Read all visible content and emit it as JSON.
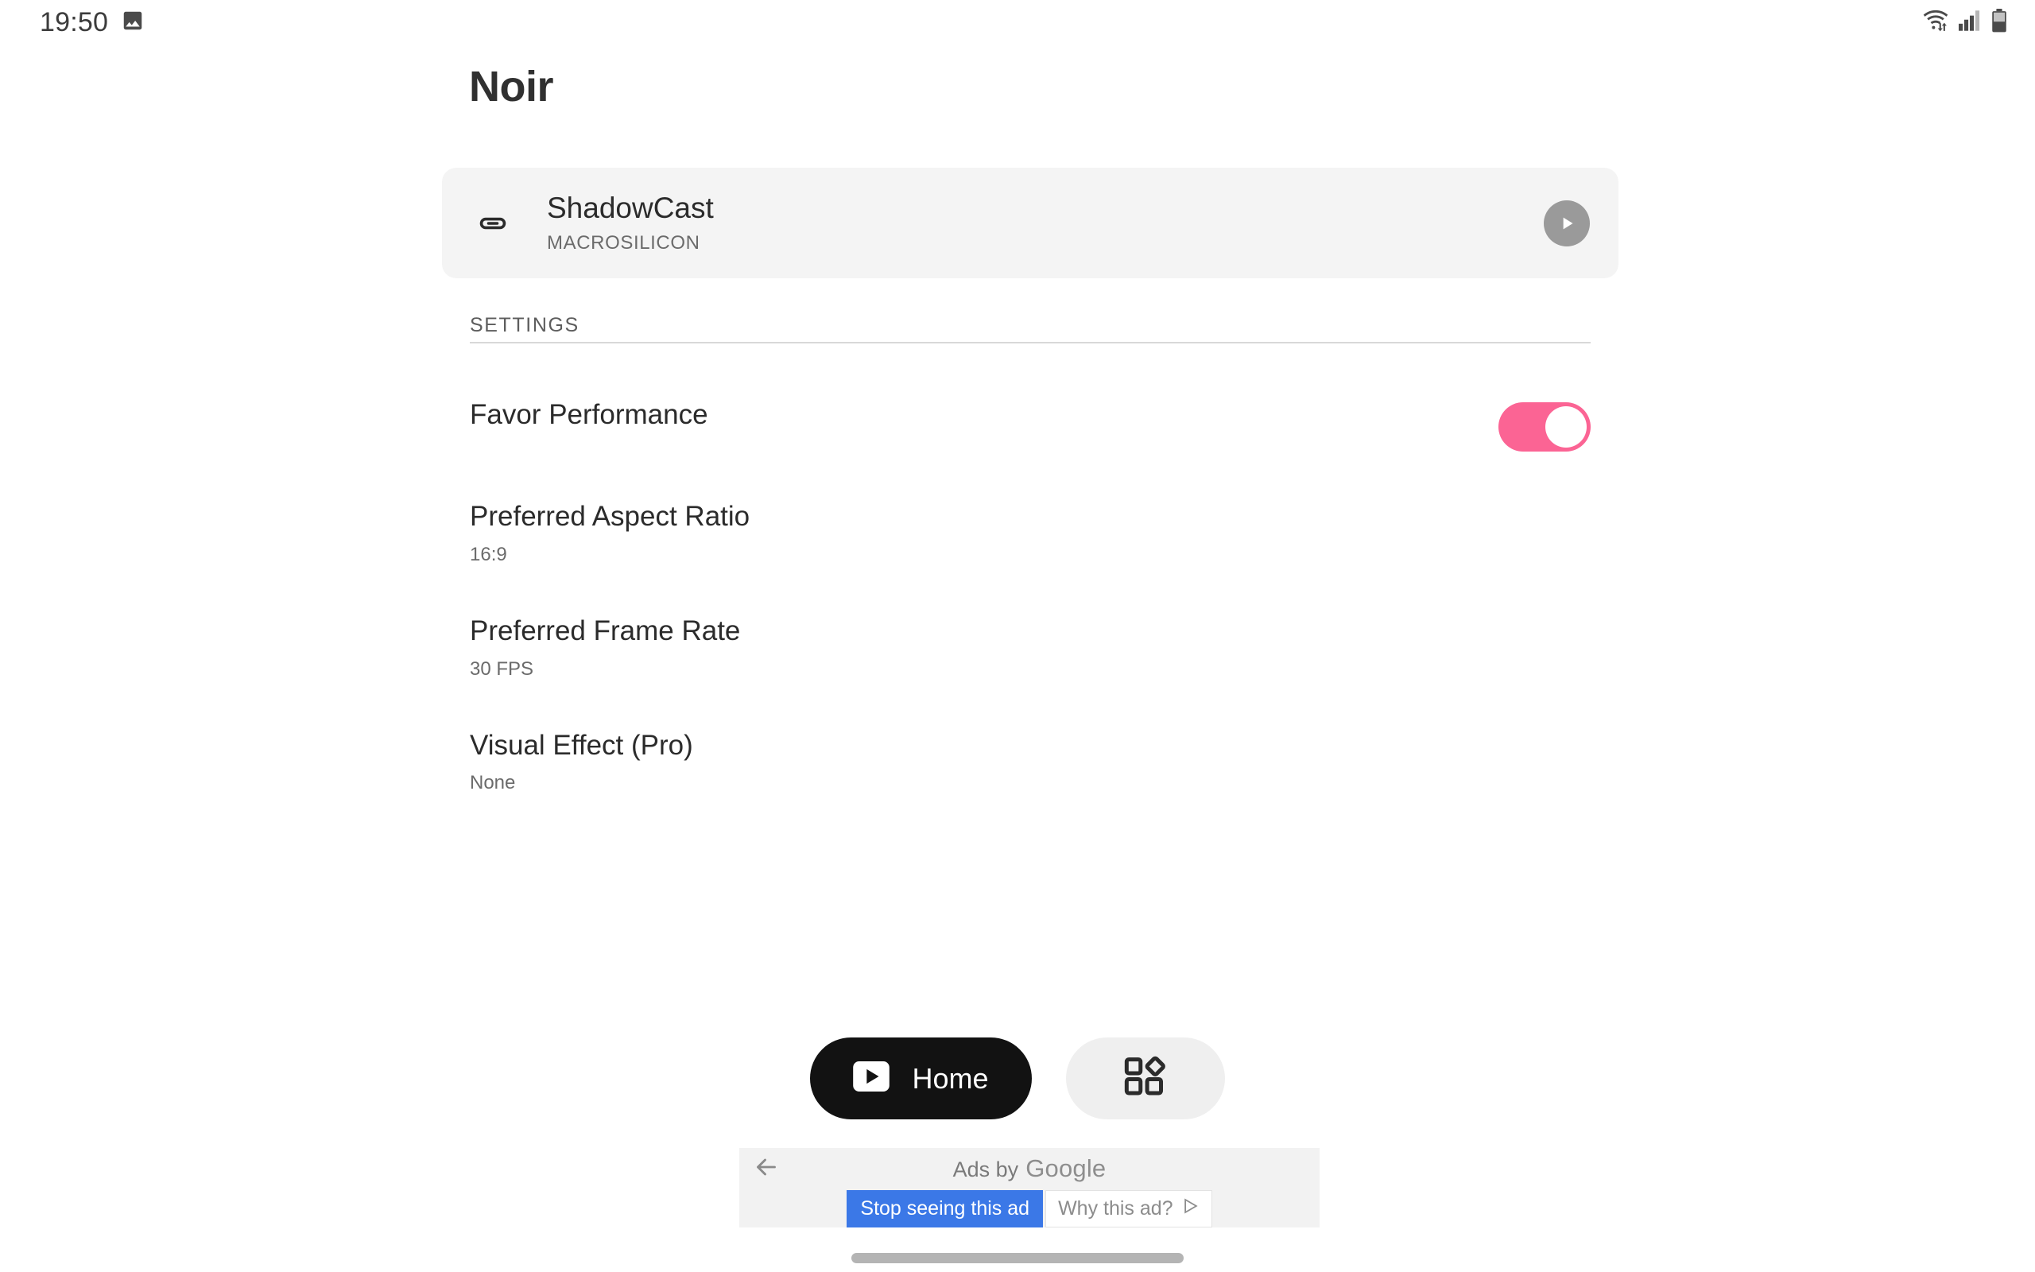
{
  "status_bar": {
    "clock": "19:50",
    "left_icons": [
      {
        "name": "screenshot-image-icon",
        "glyph": "image"
      }
    ],
    "right_icons": [
      {
        "name": "wifi-icon",
        "glyph": "wifi-transfer"
      },
      {
        "name": "cellular-signal-icon",
        "glyph": "signal-bars",
        "bars_filled": 3,
        "bars_total": 4
      },
      {
        "name": "battery-icon",
        "glyph": "battery",
        "level_percent": 55
      }
    ]
  },
  "header": {
    "title": "Noir"
  },
  "device_card": {
    "icon_name": "usb-c-port-icon",
    "name": "ShadowCast",
    "manufacturer": "MACROSILICON",
    "action_icon": "play-icon",
    "background_color": "#f4f4f4",
    "action_button_color": "#9a9a9a"
  },
  "settings": {
    "section_label": "SETTINGS",
    "items": [
      {
        "label": "Favor Performance",
        "value": "",
        "control": "toggle",
        "toggle_on": true,
        "toggle_color": "#fb6494"
      },
      {
        "label": "Preferred Aspect Ratio",
        "value": "16:9",
        "control": "value"
      },
      {
        "label": "Preferred Frame Rate",
        "value": "30 FPS",
        "control": "value"
      },
      {
        "label": "Visual Effect (Pro)",
        "value": "None",
        "control": "value"
      }
    ]
  },
  "bottom_nav": {
    "home": {
      "label": "Home",
      "icon_name": "play-rect-icon",
      "background_color": "#121212"
    },
    "apps": {
      "icon_name": "apps-grid-icon",
      "background_color": "#efefef"
    }
  },
  "ad": {
    "back_icon": "arrow-left-icon",
    "by_text": "Ads by",
    "brand": "Google",
    "stop_button": "Stop seeing this ad",
    "why_button": "Why this ad?",
    "why_icon": "adchoices-icon",
    "stop_button_color": "#3b78e7"
  },
  "gesture_bar": {
    "name": "home-indicator"
  }
}
